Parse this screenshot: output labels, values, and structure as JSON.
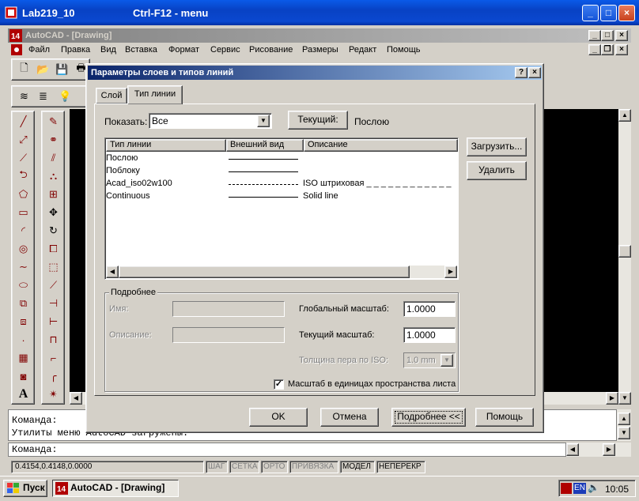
{
  "outer_window": {
    "title": "Lab219_10",
    "subtitle": "Ctrl-F12 - menu"
  },
  "app": {
    "title": "AutoCAD - [Drawing]",
    "menu": [
      "Файл",
      "Правка",
      "Вид",
      "Вставка",
      "Формат",
      "Сервис",
      "Рисование",
      "Размеры",
      "Редакт",
      "Помощь"
    ]
  },
  "dialog": {
    "title": "Параметры слоев и типов линий",
    "tabs": [
      "Слой",
      "Тип линии"
    ],
    "active_tab": "Тип линии",
    "show_label": "Показать:",
    "show_value": "Все",
    "current_button": "Текущий:",
    "current_value": "Послою",
    "table": {
      "headers": [
        "Тип линии",
        "Внешний вид",
        "Описание"
      ],
      "rows": [
        {
          "name": "Послою",
          "description": "",
          "style": "solid"
        },
        {
          "name": "Поблоку",
          "description": "",
          "style": "solid"
        },
        {
          "name": "Acad_iso02w100",
          "description": "ISO штриховая _ _ _ _ _ _ _ _ _ _ _ _",
          "style": "dashed"
        },
        {
          "name": "Continuous",
          "description": "Solid line",
          "style": "solid"
        }
      ]
    },
    "load_button": "Загрузить...",
    "delete_button": "Удалить",
    "details": {
      "group_title": "Подробнее",
      "name_label": "Имя:",
      "desc_label": "Описание:",
      "global_scale_label": "Глобальный масштаб:",
      "global_scale_value": "1.0000",
      "current_scale_label": "Текущий масштаб:",
      "current_scale_value": "1.0000",
      "pen_label": "Толщина пера по ISO:",
      "pen_value": "1.0 mm",
      "paperspace_label": "Масштаб в единицах пространства листа",
      "paperspace_checked": true
    },
    "buttons": {
      "ok": "OK",
      "cancel": "Отмена",
      "details": "Подробнее <<",
      "help": "Помощь"
    }
  },
  "command": {
    "line1": "Команда:",
    "line2": "Утилиты меню AutoCAD загружены.",
    "prompt": "Команда:"
  },
  "status": {
    "coords": "0.4154,0.4148,0.0000",
    "toggles": [
      "ШАГ",
      "СЕТКА",
      "ОРТО",
      "ПРИВЯЗКА",
      "МОДЕЛ",
      "НЕПЕРЕКР"
    ]
  },
  "taskbar": {
    "start": "Пуск",
    "task": "AutoCAD - [Drawing]",
    "lang": "EN",
    "time": "10:05"
  }
}
